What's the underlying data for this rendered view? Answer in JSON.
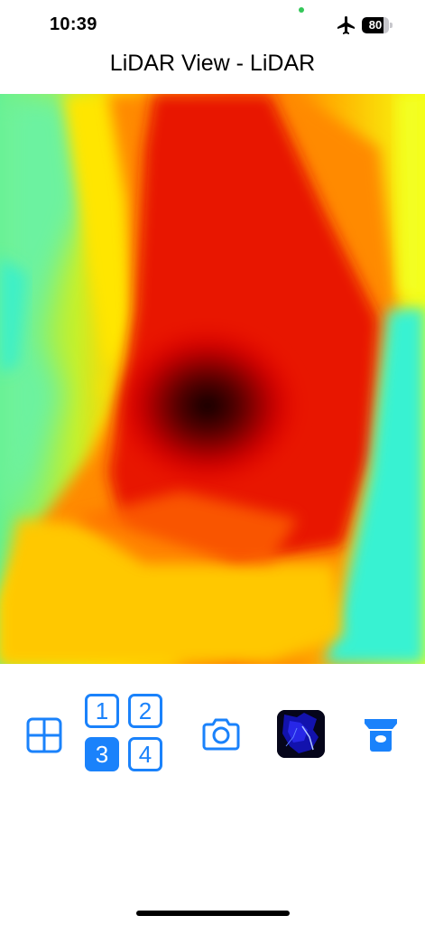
{
  "status_bar": {
    "time": "10:39",
    "airplane_mode": true,
    "battery_level": 80,
    "battery_label": "80"
  },
  "nav": {
    "title": "LiDAR View - LiDAR"
  },
  "depth_view": {
    "colormap": "jet",
    "content": "LiDAR depth map"
  },
  "toolbar": {
    "grid_icon": "grid-icon",
    "quad_layout": {
      "cells": [
        "1",
        "2",
        "3",
        "4"
      ],
      "selected": "3"
    },
    "camera_icon": "camera-icon",
    "thumbnail": "last-capture-thumbnail",
    "lidar_icon": "lidar-sensor-icon"
  },
  "colors": {
    "accent": "#1a82fb",
    "status_dot": "#34c759"
  }
}
